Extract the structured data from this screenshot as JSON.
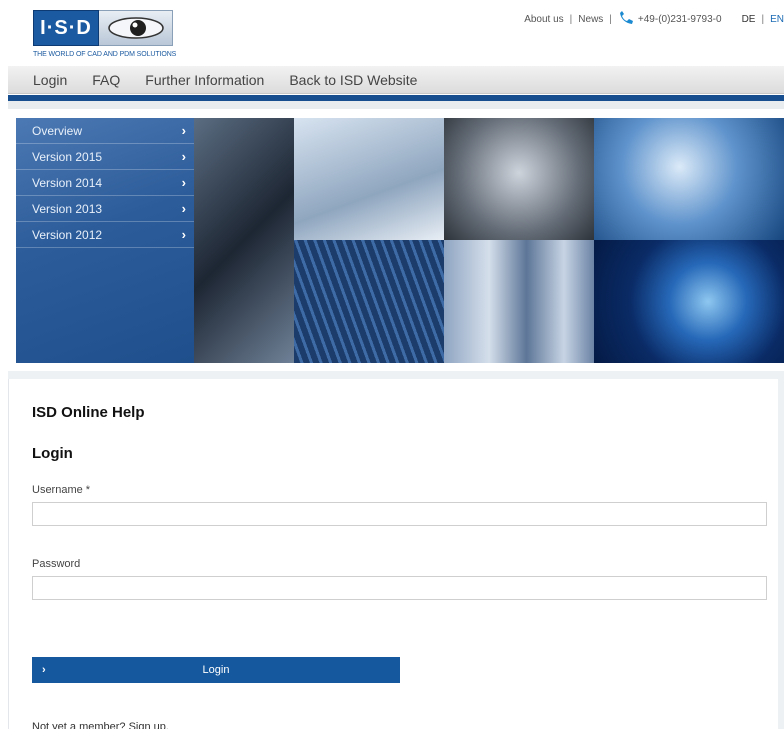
{
  "logo": {
    "letters": "I·S·D",
    "tagline": "THE WORLD OF CAD AND PDM SOLUTIONS"
  },
  "topnav": {
    "about": "About us",
    "news": "News",
    "phone": "+49-(0)231-9793-0",
    "lang_de": "DE",
    "lang_en": "EN"
  },
  "mainnav": {
    "items": [
      "Login",
      "FAQ",
      "Further Information",
      "Back to ISD Website"
    ]
  },
  "sidebar": {
    "items": [
      {
        "label": "Overview"
      },
      {
        "label": "Version 2015"
      },
      {
        "label": "Version 2014"
      },
      {
        "label": "Version 2013"
      },
      {
        "label": "Version 2012"
      }
    ]
  },
  "content": {
    "site_title": "ISD Online Help",
    "page_title": "Login",
    "username_label": "Username *",
    "username_value": "",
    "password_label": "Password",
    "password_value": "",
    "login_button": "Login",
    "signup_text": "Not yet a member? Sign up."
  },
  "colors": {
    "brand_blue": "#15589e",
    "nav_bar": "#dcdcdc",
    "link_blue": "#1b6bb5"
  }
}
